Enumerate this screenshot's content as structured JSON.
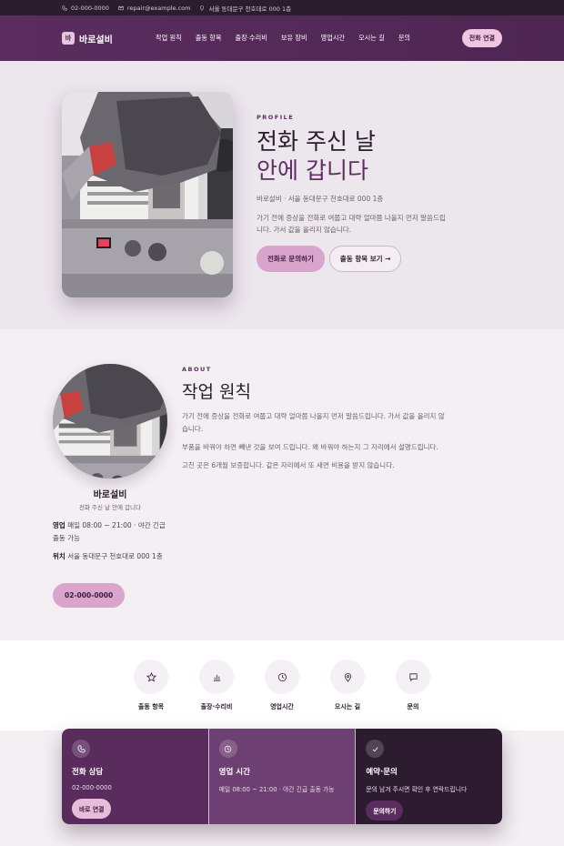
{
  "topbar": {
    "phone": "02-000-0000",
    "email": "repair@example.com",
    "address": "서울 동대문구 천호대로 000 1층"
  },
  "nav": {
    "logo_badge": "바",
    "logo_text": "바로설비",
    "items": [
      "작업 원칙",
      "출동 항목",
      "출장·수리비",
      "보유 장비",
      "영업시간",
      "오시는 길",
      "문의"
    ],
    "cta": "전화 연결"
  },
  "hero": {
    "kicker": "PROFILE",
    "title_line1": "전화 주신 날",
    "title_line2": "안에 갑니다",
    "meta": "바로설비 · 서울 동대문구 천호대로 000 1층",
    "desc": "가기 전에 증상을 전화로 여쭙고 대략 얼마쯤 나올지 먼저 말씀드립니다. 가서 값을 올리지 않습니다.",
    "btn_primary": "전화로 문의하기",
    "btn_secondary": "출동 항목 보기 →"
  },
  "about": {
    "kicker": "ABOUT",
    "title": "작업 원칙",
    "p1": "가기 전에 증상을 전화로 여쭙고 대략 얼마쯤 나올지 먼저 말씀드립니다. 가서 값을 올리지 않습니다.",
    "p2": "부품을 바꿔야 하면 빼낸 것을 보여 드립니다. 왜 바꿔야 하는지 그 자리에서 설명드립니다.",
    "p3": "고친 곳은 6개월 보증합니다. 같은 자리에서 또 새면 비용을 받지 않습니다.",
    "profile_name": "바로설비",
    "profile_tagline": "전화 주신 날 안에 갑니다",
    "hours_label": "영업",
    "hours_value": "매일 08:00 ~ 21:00 · 야간 긴급 출동 가능",
    "location_label": "위치",
    "location_value": "서울 동대문구 천호대로 000 1층",
    "phone_button": "02-000-0000"
  },
  "quicklinks": [
    {
      "icon": "star-icon",
      "label": "출동 항목"
    },
    {
      "icon": "bar-chart-icon",
      "label": "출장·수리비"
    },
    {
      "icon": "clock-icon",
      "label": "영업시간"
    },
    {
      "icon": "map-pin-icon",
      "label": "오시는 길"
    },
    {
      "icon": "chat-icon",
      "label": "문의"
    }
  ],
  "cards": [
    {
      "icon": "phone-icon",
      "title": "전화 상담",
      "sub": "02-000-0000",
      "button": "바로 연결"
    },
    {
      "icon": "clock-icon",
      "title": "영업 시간",
      "sub": "매일 08:00 ~ 21:00 · 야간 긴급 출동 가능"
    },
    {
      "icon": "check-icon",
      "title": "예약·문의",
      "sub": "문의 남겨 주시면 확인 후 연락드립니다",
      "button": "문의하기"
    }
  ],
  "colors": {
    "brand": "#5a2d5e",
    "accent": "#d9a5cc",
    "dark": "#2b1c2e"
  }
}
